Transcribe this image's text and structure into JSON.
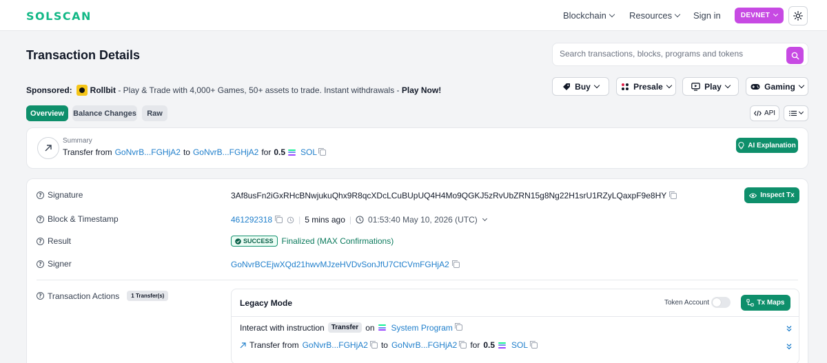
{
  "header": {
    "logo": "SOLSCAN",
    "nav": [
      "Blockchain",
      "Resources"
    ],
    "signin": "Sign in",
    "network": "DEVNET"
  },
  "page": {
    "title": "Transaction Details",
    "search_placeholder": "Search transactions, blocks, programs and tokens"
  },
  "sponsored": {
    "label": "Sponsored:",
    "brand": "Rollbit",
    "text": " - Play & Trade with 4,000+ Games, 50+ assets to trade. Instant withdrawals - ",
    "cta": "Play Now!"
  },
  "ad_buttons": [
    "Buy",
    "Presale",
    "Play",
    "Gaming"
  ],
  "tabs": [
    "Overview",
    "Balance Changes",
    "Raw"
  ],
  "tools": {
    "api": "API"
  },
  "summary": {
    "label": "Summary",
    "text_transfer_from": "Transfer from",
    "from": "GoNvrB...FGHjA2",
    "text_to": "to",
    "to": "GoNvrB...FGHjA2",
    "text_for": "for",
    "amount": "0.5",
    "token": "SOL",
    "ai_button": "AI Explanation"
  },
  "details": {
    "signature_label": "Signature",
    "signature": "3Af8usFn2iGxRHcBNwjukuQhx9R8qcXDcLCuBUpUQ4H4Mo9QGKJ5zRvUbZRN15g8Ng22H1srU1RZyLQaxpF9e8HY",
    "inspect_button": "Inspect Tx",
    "block_label": "Block & Timestamp",
    "block": "461292318",
    "age": "5 mins ago",
    "timestamp": "01:53:40 May 10, 2026 (UTC)",
    "result_label": "Result",
    "result_status": "SUCCESS",
    "result_text": "Finalized (MAX Confirmations)",
    "signer_label": "Signer",
    "signer": "GoNvrBCEjwXQd21hwvMJzeHVDvSonJfU7CtCVmFGHjA2",
    "actions_label": "Transaction Actions",
    "actions_count": "1 Transfer(s)"
  },
  "actions": {
    "mode_title": "Legacy Mode",
    "token_account_label": "Token Account",
    "txmaps_button": "Tx Maps",
    "interact_text": "Interact with instruction",
    "instruction": "Transfer",
    "on_text": "on",
    "program": "System Program",
    "transfer_text": "Transfer from",
    "from": "GoNvrB...FGHjA2",
    "to_text": "to",
    "to": "GoNvrB...FGHjA2",
    "for_text": "for",
    "amount": "0.5",
    "token": "SOL"
  },
  "colors": {
    "accent": "#0e8f6b",
    "brand": "#12b886",
    "devnet": "#c74ae3",
    "link": "#1e7ecb"
  }
}
